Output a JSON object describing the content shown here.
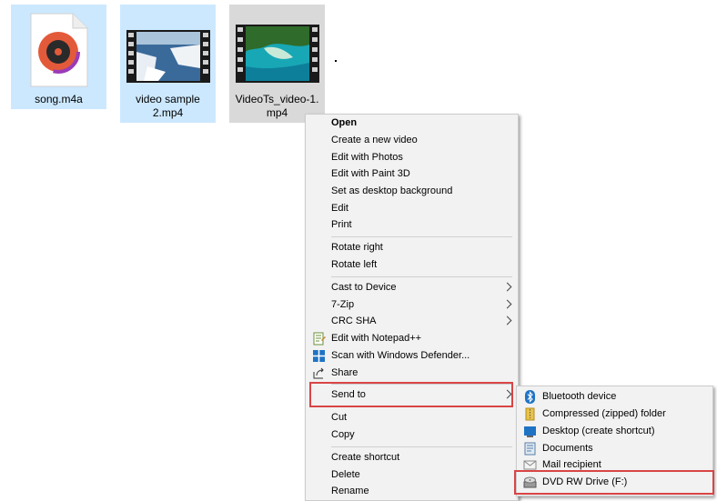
{
  "files": [
    {
      "name": "song.m4a",
      "icon": "audio-file-icon",
      "selected": false
    },
    {
      "name_line1": "video sample",
      "name_line2": "2.mp4",
      "icon": "video-thumbnail-icon",
      "selected": false
    },
    {
      "name_line1": "VideoTs_video-1.",
      "name_line2": "mp4",
      "icon": "video-thumbnail-icon",
      "selected": true
    }
  ],
  "context_menu": {
    "items": [
      {
        "label": "Open",
        "bold": true
      },
      {
        "label": "Create a new video"
      },
      {
        "label": "Edit with Photos"
      },
      {
        "label": "Edit with Paint 3D"
      },
      {
        "label": "Set as desktop background"
      },
      {
        "label": "Edit"
      },
      {
        "label": "Print"
      },
      {
        "label": "Rotate right"
      },
      {
        "label": "Rotate left"
      },
      {
        "label": "Cast to Device",
        "submenu": true
      },
      {
        "label": "7-Zip",
        "submenu": true
      },
      {
        "label": "CRC SHA",
        "submenu": true
      },
      {
        "label": "Edit with Notepad++",
        "icon": "notepad-plus-plus-icon"
      },
      {
        "label": "Scan with Windows Defender...",
        "icon": "windows-defender-icon"
      },
      {
        "label": "Share",
        "icon": "share-icon"
      },
      {
        "label": "Send to",
        "submenu": true,
        "highlighted": true
      },
      {
        "label": "Cut"
      },
      {
        "label": "Copy"
      },
      {
        "label": "Create shortcut"
      },
      {
        "label": "Delete"
      },
      {
        "label": "Rename"
      }
    ]
  },
  "send_to_menu": {
    "items": [
      {
        "label": "Bluetooth device",
        "icon": "bluetooth-icon"
      },
      {
        "label": "Compressed (zipped) folder",
        "icon": "zip-folder-icon"
      },
      {
        "label": "Desktop (create shortcut)",
        "icon": "desktop-icon"
      },
      {
        "label": "Documents",
        "icon": "documents-icon"
      },
      {
        "label": "Mail recipient",
        "icon": "mail-icon"
      },
      {
        "label": "DVD RW Drive (F:)",
        "icon": "dvd-drive-icon",
        "highlighted": true
      }
    ]
  },
  "colors": {
    "selection_bg": "#cce8ff",
    "selected_file_bg": "#d9d9d9",
    "menu_bg": "#f2f2f2",
    "highlight_border": "#d94545"
  }
}
